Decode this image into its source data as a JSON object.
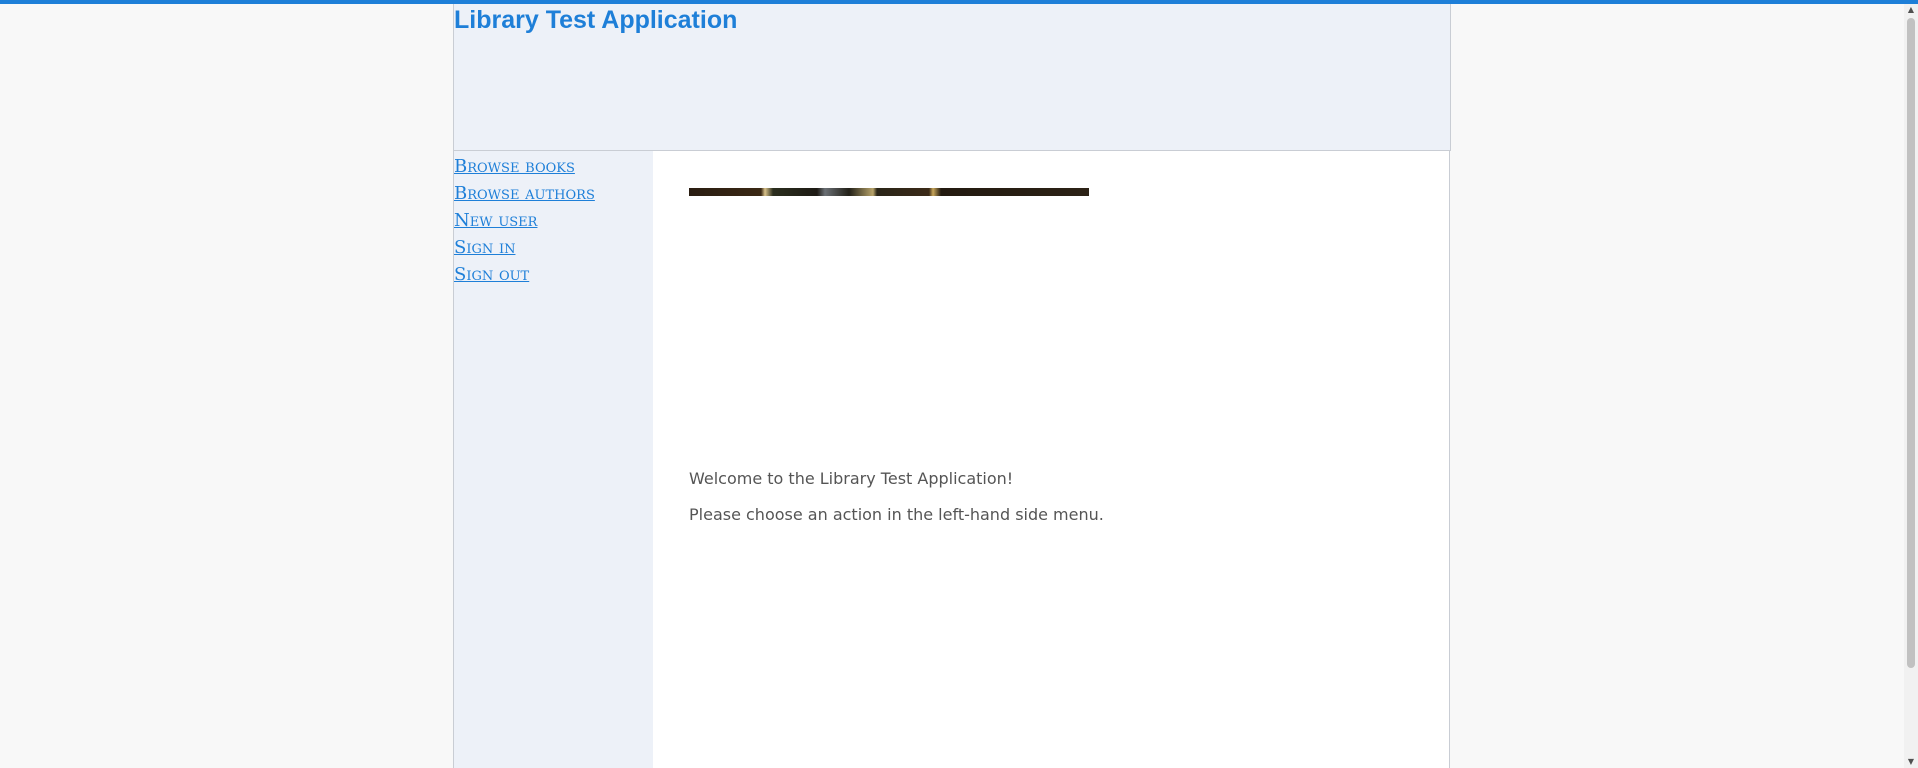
{
  "header": {
    "title": "Library Test Application"
  },
  "sidebar": {
    "items": [
      {
        "label": "Browse books"
      },
      {
        "label": "Browse authors"
      },
      {
        "label": "New user"
      },
      {
        "label": "Sign in"
      },
      {
        "label": "Sign out"
      }
    ]
  },
  "main": {
    "welcome_text": "Welcome to the Library Test Application!",
    "instruction_text": "Please choose an action in the left-hand side menu."
  },
  "colors": {
    "accent": "#1e7fd8",
    "panel_background": "#edf1f8",
    "body_text": "#555555"
  },
  "icons": {
    "scroll_up": "chevron-up-icon",
    "scroll_down": "chevron-down-icon"
  }
}
